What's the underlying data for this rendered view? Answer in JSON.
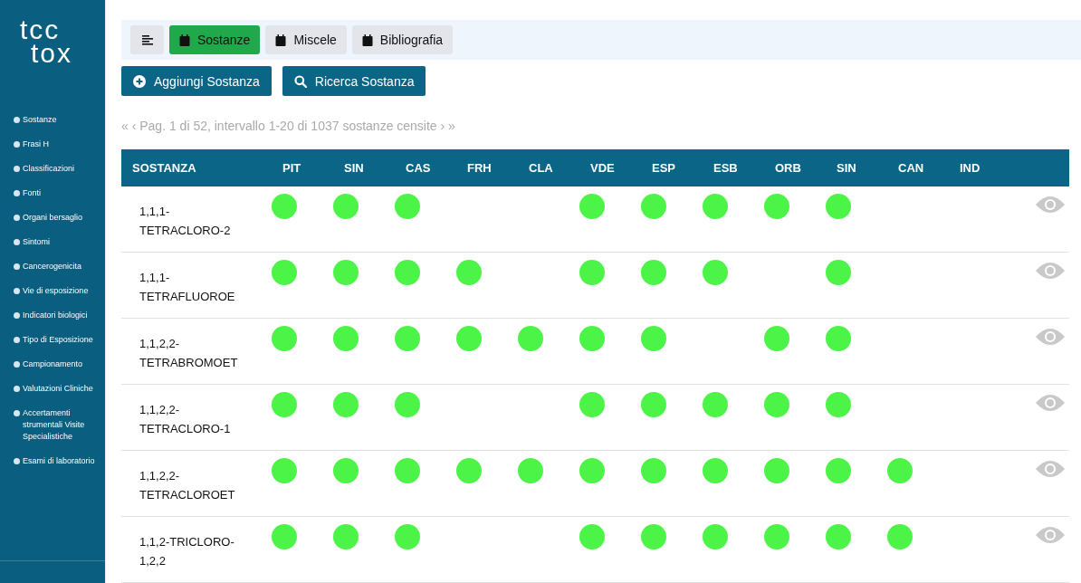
{
  "sidebar": {
    "logo": {
      "top": "tcc",
      "bottom": "tox"
    },
    "items": [
      {
        "label": "Sostanze"
      },
      {
        "label": "Frasi H"
      },
      {
        "label": "Classificazioni"
      },
      {
        "label": "Fonti"
      },
      {
        "label": "Organi bersaglio"
      },
      {
        "label": "Sintomi"
      },
      {
        "label": "Cancerogenicita"
      },
      {
        "label": "Vie di esposizione"
      },
      {
        "label": "Indicatori biologici"
      },
      {
        "label": "Tipo di Esposizione"
      },
      {
        "label": "Campionamento"
      },
      {
        "label": "Valutazioni Cliniche"
      },
      {
        "label": "Accertamenti strumentali Visite Specialistiche"
      },
      {
        "label": "Esami di laboratorio"
      }
    ]
  },
  "tabs": [
    {
      "label": "Sostanze",
      "selected": true
    },
    {
      "label": "Miscele",
      "selected": false
    },
    {
      "label": "Bibliografia",
      "selected": false
    }
  ],
  "actions": [
    {
      "label": "Aggiungi Sostanza",
      "kind": "add"
    },
    {
      "label": "Ricerca Sostanza",
      "kind": "search"
    }
  ],
  "pagination": "« ‹ Pag. 1 di 52, intervallo 1-20 di 1037 sostanze censite › »",
  "table": {
    "columns": [
      "SOSTANZA",
      "PIT",
      "SIN",
      "CAS",
      "FRH",
      "CLA",
      "VDE",
      "ESP",
      "ESB",
      "ORB",
      "SIN",
      "CAN",
      "IND"
    ],
    "rows": [
      {
        "name": "1,1,1-TETRACLORO-2",
        "flags": [
          true,
          true,
          true,
          false,
          false,
          true,
          true,
          true,
          true,
          true,
          false,
          false
        ]
      },
      {
        "name": "1,1,1-TETRAFLUOROE",
        "flags": [
          true,
          true,
          true,
          true,
          false,
          true,
          true,
          true,
          false,
          true,
          false,
          false
        ]
      },
      {
        "name": "1,1,2,2-TETRABROMOET",
        "flags": [
          true,
          true,
          true,
          true,
          true,
          true,
          true,
          false,
          true,
          true,
          false,
          false
        ]
      },
      {
        "name": "1,1,2,2-TETRACLORO-1",
        "flags": [
          true,
          true,
          true,
          false,
          false,
          true,
          true,
          true,
          true,
          true,
          false,
          false
        ]
      },
      {
        "name": "1,1,2,2-TETRACLOROET",
        "flags": [
          true,
          true,
          true,
          true,
          true,
          true,
          true,
          true,
          true,
          true,
          true,
          false
        ]
      },
      {
        "name": "1,1,2-TRICLORO-1,2,2",
        "flags": [
          true,
          true,
          true,
          false,
          false,
          true,
          true,
          true,
          true,
          true,
          true,
          false
        ]
      }
    ]
  }
}
